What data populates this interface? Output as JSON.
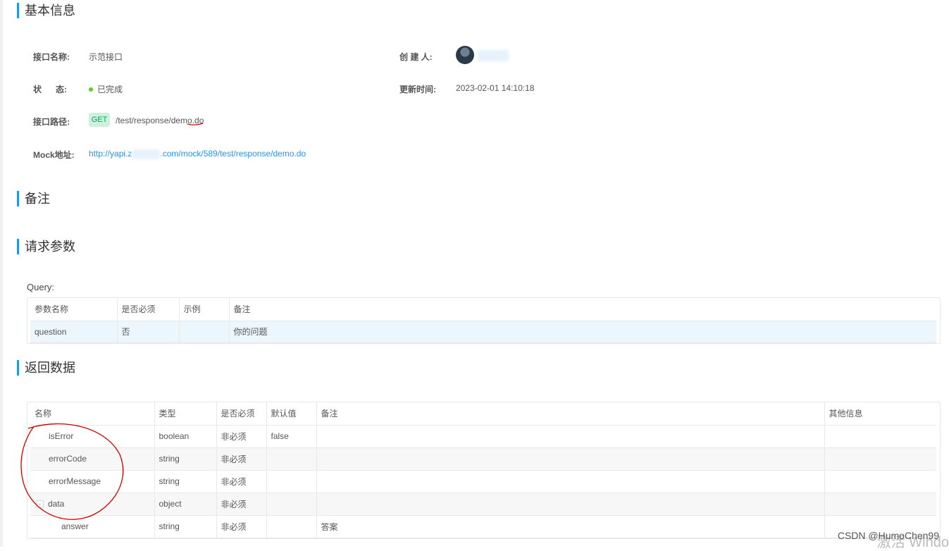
{
  "sections": {
    "basic_info": "基本信息",
    "remark": "备注",
    "request_params": "请求参数",
    "response_data": "返回数据"
  },
  "info": {
    "name_label": "接口名称:",
    "name_value": "示范接口",
    "creator_label": "创 建 人:",
    "status_label": "状      态:",
    "status_value": "已完成",
    "updated_label": "更新时间:",
    "updated_value": "2023-02-01 14:10:18",
    "path_label": "接口路径:",
    "method": "GET",
    "path_value": "/test/response/demo.do",
    "mock_label": "Mock地址:",
    "mock_prefix": "http://yapi.z",
    "mock_suffix": ".com/mock/589/test/response/demo.do"
  },
  "query": {
    "label": "Query:",
    "headers": [
      "参数名称",
      "是否必须",
      "示例",
      "备注"
    ],
    "rows": [
      [
        "question",
        "否",
        "",
        "你的问题"
      ]
    ]
  },
  "response": {
    "headers": [
      "名称",
      "类型",
      "是否必须",
      "默认值",
      "备注",
      "其他信息"
    ],
    "rows": [
      {
        "name": "isError",
        "type": "boolean",
        "required": "非必须",
        "default": "false",
        "remark": "",
        "other": ""
      },
      {
        "name": "errorCode",
        "type": "string",
        "required": "非必须",
        "default": "",
        "remark": "",
        "other": ""
      },
      {
        "name": "errorMessage",
        "type": "string",
        "required": "非必须",
        "default": "",
        "remark": "",
        "other": ""
      },
      {
        "name": "data",
        "type": "object",
        "required": "非必须",
        "default": "",
        "remark": "",
        "other": "",
        "expand": "-"
      },
      {
        "name": "answer",
        "type": "string",
        "required": "非必须",
        "default": "",
        "remark": "答案",
        "other": ""
      }
    ]
  },
  "watermark": "CSDN @HumoChen99",
  "watermark2": "激活 Windo",
  "colors": {
    "accent": "#2395f1",
    "status_ok": "#57cf27",
    "annotation_red": "#cc0000"
  }
}
